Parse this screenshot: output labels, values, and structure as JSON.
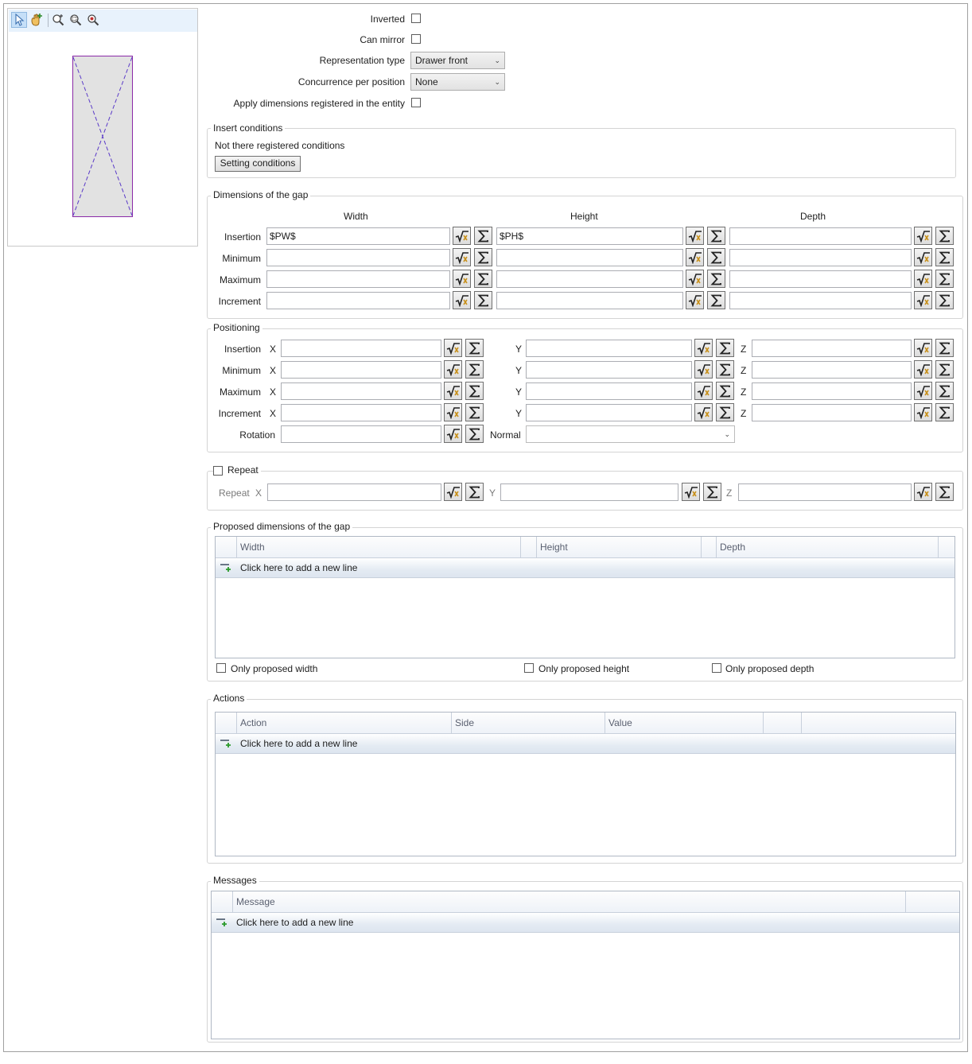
{
  "toolbar": {
    "icons": [
      "pointer-icon",
      "hand-add-icon",
      "zoom-extents-icon",
      "zoom-window-icon",
      "zoom-icon"
    ]
  },
  "general": {
    "inverted_label": "Inverted",
    "can_mirror_label": "Can mirror",
    "representation_type_label": "Representation type",
    "representation_type_value": "Drawer front",
    "concurrence_label": "Concurrence per position",
    "concurrence_value": "None",
    "apply_dims_label": "Apply dimensions registered in the entity"
  },
  "insert_conditions": {
    "title": "Insert conditions",
    "status": "Not there registered conditions",
    "button": "Setting conditions"
  },
  "dimensions": {
    "title": "Dimensions of the gap",
    "columns": [
      "Width",
      "Height",
      "Depth"
    ],
    "rows": [
      {
        "label": "Insertion",
        "values": [
          "$PW$",
          "$PH$",
          ""
        ]
      },
      {
        "label": "Minimum",
        "values": [
          "",
          "",
          ""
        ]
      },
      {
        "label": "Maximum",
        "values": [
          "",
          "",
          ""
        ]
      },
      {
        "label": "Increment",
        "values": [
          "",
          "",
          ""
        ]
      }
    ]
  },
  "positioning": {
    "title": "Positioning",
    "axis_x": "X",
    "axis_y": "Y",
    "axis_z": "Z",
    "rows": [
      {
        "label": "Insertion",
        "values": [
          "",
          "",
          ""
        ]
      },
      {
        "label": "Minimum",
        "values": [
          "",
          "",
          ""
        ]
      },
      {
        "label": "Maximum",
        "values": [
          "",
          "",
          ""
        ]
      },
      {
        "label": "Increment",
        "values": [
          "",
          "",
          ""
        ]
      }
    ],
    "rotation_label": "Rotation",
    "rotation_value": "",
    "normal_label": "Normal",
    "normal_value": ""
  },
  "repeat": {
    "title": "Repeat",
    "row_label": "Repeat",
    "axis_x": "X",
    "axis_y": "Y",
    "axis_z": "Z",
    "values": [
      "",
      "",
      ""
    ]
  },
  "proposed": {
    "title": "Proposed dimensions of the gap",
    "columns": [
      "Width",
      "Height",
      "Depth"
    ],
    "new_line": "Click here to add a new line",
    "only_width": "Only proposed width",
    "only_height": "Only proposed height",
    "only_depth": "Only proposed depth"
  },
  "actions": {
    "title": "Actions",
    "columns": [
      "Action",
      "Side",
      "Value"
    ],
    "new_line": "Click here to add a new line"
  },
  "messages": {
    "title": "Messages",
    "columns": [
      "Message"
    ],
    "new_line": "Click here to add a new line"
  }
}
